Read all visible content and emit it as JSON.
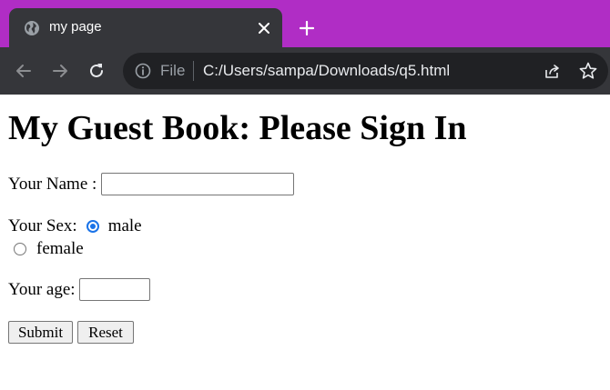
{
  "browser": {
    "tab_title": "my page",
    "url_scheme": "File",
    "url": "C:/Users/sampa/Downloads/q5.html",
    "colors": {
      "frame": "#b02dc5",
      "toolbar": "#35363a",
      "omnibox": "#202124"
    }
  },
  "page": {
    "heading": "My Guest Book: Please Sign In",
    "form": {
      "name_label": "Your Name :",
      "name_value": "",
      "sex_label": "Your Sex:",
      "sex_options": [
        {
          "label": "male",
          "checked": true
        },
        {
          "label": "female",
          "checked": false
        }
      ],
      "age_label": "Your age:",
      "age_value": "",
      "submit_label": "Submit",
      "reset_label": "Reset"
    }
  }
}
